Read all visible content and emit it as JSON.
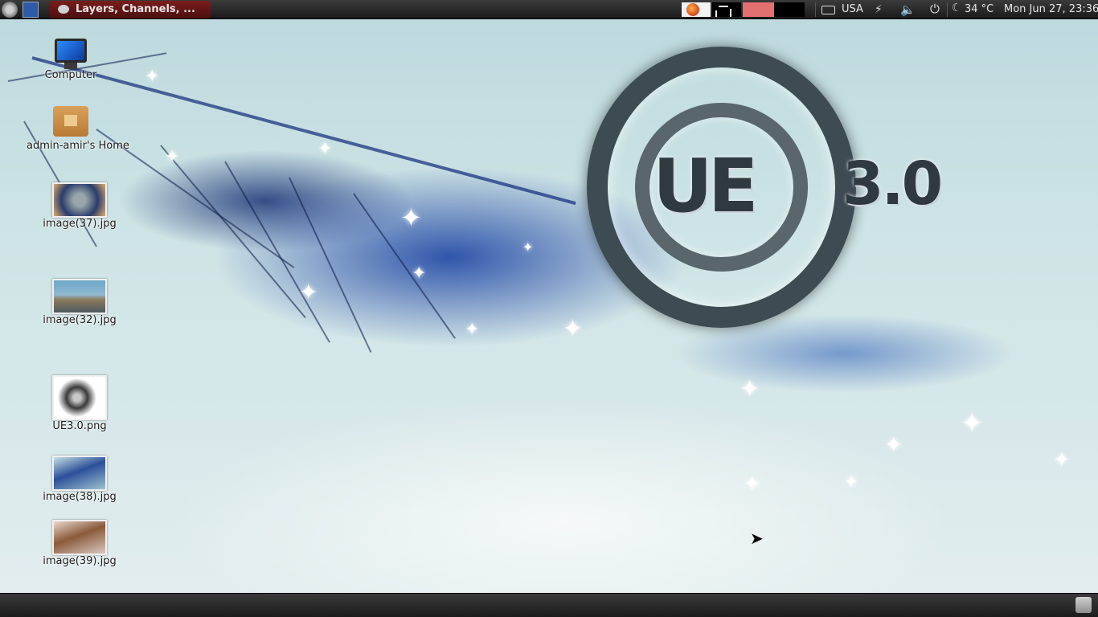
{
  "top_panel": {
    "active_window_label": "Layers, Channels, ...",
    "keyboard_layout": "USA",
    "weather": "34 °C",
    "clock": "Mon Jun 27, 23:36"
  },
  "desktop": {
    "icons": [
      {
        "label": "Computer"
      },
      {
        "label": "admin-amir's Home"
      },
      {
        "label": "image(37).jpg"
      },
      {
        "label": "image(32).jpg"
      },
      {
        "label": "UE3.0.png"
      },
      {
        "label": "image(38).jpg"
      },
      {
        "label": "image(39).jpg"
      }
    ],
    "wallpaper_logo": {
      "main_text": "UE",
      "version_text": "3.0"
    }
  },
  "colors": {
    "panel_bg": "#1a1a1a",
    "task_button": "#7a1d1d",
    "cpu_meter": "#e27070",
    "wallpaper_blue": "#1e4fb0"
  },
  "icons": {
    "menu": "ubuntu-menu-icon",
    "show_desktop": "show-desktop-icon",
    "task": "gimp-icon",
    "browser": "firefox-icon",
    "keyboard": "keyboard-icon",
    "network": "network-icon",
    "volume": "volume-icon",
    "power": "power-icon",
    "weather": "moon-icon",
    "trash": "trash-icon"
  }
}
